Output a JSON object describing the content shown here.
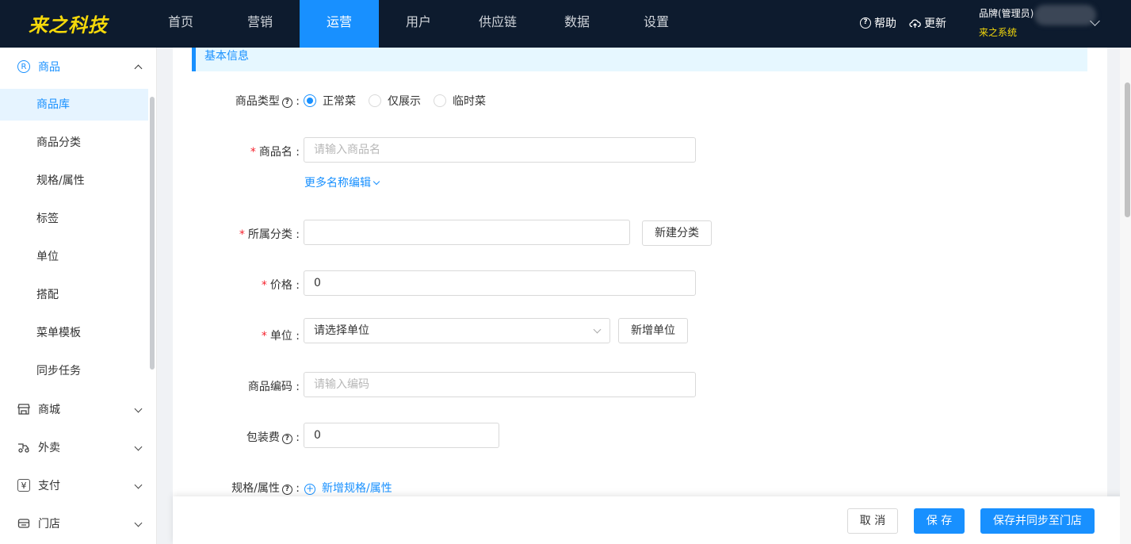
{
  "topbar": {
    "logo": "来之科技",
    "nav": [
      {
        "label": "首页",
        "active": false
      },
      {
        "label": "营销",
        "active": false
      },
      {
        "label": "运营",
        "active": true
      },
      {
        "label": "用户",
        "active": false
      },
      {
        "label": "供应链",
        "active": false
      },
      {
        "label": "数据",
        "active": false
      },
      {
        "label": "设置",
        "active": false
      }
    ],
    "help": "帮助",
    "update": "更新",
    "brand": "品牌(管理员)",
    "system": "来之系统"
  },
  "sidebar": {
    "groups": [
      {
        "label": "商品",
        "icon": "goods-icon",
        "open": true
      },
      {
        "label": "商城",
        "icon": "shop-icon",
        "open": false
      },
      {
        "label": "外卖",
        "icon": "delivery-icon",
        "open": false
      },
      {
        "label": "支付",
        "icon": "yen-icon",
        "open": false
      },
      {
        "label": "门店",
        "icon": "store-icon",
        "open": false
      }
    ],
    "items": [
      {
        "label": "商品库",
        "active": true
      },
      {
        "label": "商品分类",
        "active": false
      },
      {
        "label": "规格/属性",
        "active": false
      },
      {
        "label": "标签",
        "active": false
      },
      {
        "label": "单位",
        "active": false
      },
      {
        "label": "搭配",
        "active": false
      },
      {
        "label": "菜单模板",
        "active": false
      },
      {
        "label": "同步任务",
        "active": false
      }
    ]
  },
  "form": {
    "section_title": "基本信息",
    "product_type": {
      "label": "商品类型",
      "options": [
        "正常菜",
        "仅展示",
        "临时菜"
      ],
      "selected": "正常菜"
    },
    "name": {
      "label": "商品名",
      "placeholder": "请输入商品名",
      "more_link": "更多名称编辑"
    },
    "category": {
      "label": "所属分类",
      "value": "",
      "new_button": "新建分类"
    },
    "price": {
      "label": "价格",
      "value": "0"
    },
    "unit": {
      "label": "单位",
      "placeholder": "请选择单位",
      "new_button": "新增单位"
    },
    "code": {
      "label": "商品编码",
      "placeholder": "请输入编码"
    },
    "packing_fee": {
      "label": "包装费",
      "value": "0"
    },
    "spec": {
      "label": "规格/属性",
      "add_link": "新增规格/属性"
    }
  },
  "footer": {
    "cancel": "取 消",
    "save": "保 存",
    "save_sync": "保存并同步至门店"
  },
  "colors": {
    "primary": "#1890ff",
    "topbar_bg": "#0d1b2e",
    "logo": "#f5d90a",
    "required": "#f5222d"
  }
}
